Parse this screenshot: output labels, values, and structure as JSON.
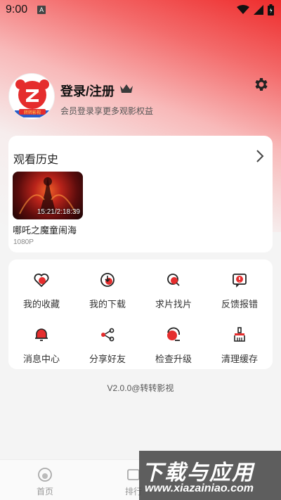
{
  "status_bar": {
    "time": "9:00",
    "notification_letter": "A"
  },
  "profile": {
    "title": "登录/注册",
    "subtitle": "会员登录享更多观影权益",
    "avatar_badge": "转转影视"
  },
  "history": {
    "title": "观看历史",
    "items": [
      {
        "title": "哪吒之魔童闹海",
        "progress": "15:21/2:18:39",
        "quality": "1080P"
      }
    ]
  },
  "features": [
    {
      "label": "我的收藏",
      "icon": "heart-icon"
    },
    {
      "label": "我的下载",
      "icon": "download-icon"
    },
    {
      "label": "求片找片",
      "icon": "search-film-icon"
    },
    {
      "label": "反馈报错",
      "icon": "feedback-icon"
    },
    {
      "label": "消息中心",
      "icon": "bell-icon"
    },
    {
      "label": "分享好友",
      "icon": "share-icon"
    },
    {
      "label": "检查升级",
      "icon": "upgrade-icon"
    },
    {
      "label": "清理缓存",
      "icon": "clean-icon"
    }
  ],
  "version": "V2.0.0@转转影视",
  "bottom_nav": [
    {
      "label": "首页",
      "icon": "home-icon"
    },
    {
      "label": "排行",
      "icon": "rank-icon"
    }
  ],
  "watermark": {
    "main": "下载与应用",
    "url": "www.xiazainiao.com"
  },
  "colors": {
    "accent": "#e52d2d",
    "background": "#f4f4f4"
  }
}
